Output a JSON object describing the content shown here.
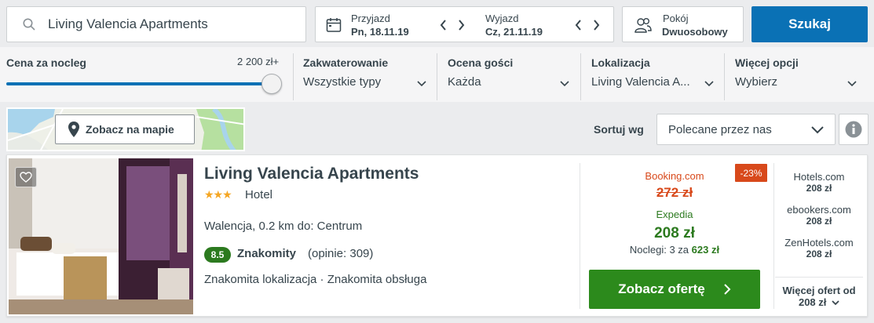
{
  "search": {
    "value": "Living Valencia Apartments",
    "icon": "search-icon"
  },
  "dates": {
    "checkin_label": "Przyjazd",
    "checkin_value": "Pn, 18.11.19",
    "checkout_label": "Wyjazd",
    "checkout_value": "Cz, 21.11.19"
  },
  "rooms": {
    "label": "Pokój",
    "value": "Dwuosobowy"
  },
  "search_button": "Szukaj",
  "filters": {
    "price": {
      "title": "Cena za nocleg",
      "max_label": "2 200 zł+",
      "level": 1.0
    },
    "accommodation": {
      "title": "Zakwaterowanie",
      "value": "Wszystkie typy"
    },
    "guest_rating": {
      "title": "Ocena gości",
      "value": "Każda"
    },
    "location": {
      "title": "Lokalizacja",
      "value": "Living Valencia A..."
    },
    "more": {
      "title": "Więcej opcji",
      "value": "Wybierz"
    }
  },
  "map_button": "Zobacz na mapie",
  "sort": {
    "label": "Sortuj wg",
    "value": "Polecane przez nas"
  },
  "result": {
    "name": "Living Valencia Apartments",
    "stars": "★★★",
    "type": "Hotel",
    "location": "Walencja, 0.2 km do: Centrum",
    "rating_score": "8.5",
    "rating_word": "Znakomity",
    "rating_count": "(opinie: 309)",
    "features": "Znakomita lokalizacja · Znakomita obsługa",
    "deal": {
      "old_source": "Booking.com",
      "old_price": "272 zł",
      "discount": "-23%",
      "source": "Expedia",
      "price": "208 zł",
      "nights_prefix": "Noclegi: 3 za",
      "nights_total": "623 zł",
      "button": "Zobacz ofertę"
    },
    "alternatives": [
      {
        "site": "Hotels.com",
        "price": "208 zł"
      },
      {
        "site": "ebookers.com",
        "price": "208 zł"
      },
      {
        "site": "ZenHotels.com",
        "price": "208 zł"
      }
    ],
    "more_offers_label": "Więcej ofert od",
    "more_offers_price": "208 zł"
  },
  "colors": {
    "accent": "#0a71b5",
    "deal_green": "#2c7a1f",
    "discount": "#d8491b"
  }
}
